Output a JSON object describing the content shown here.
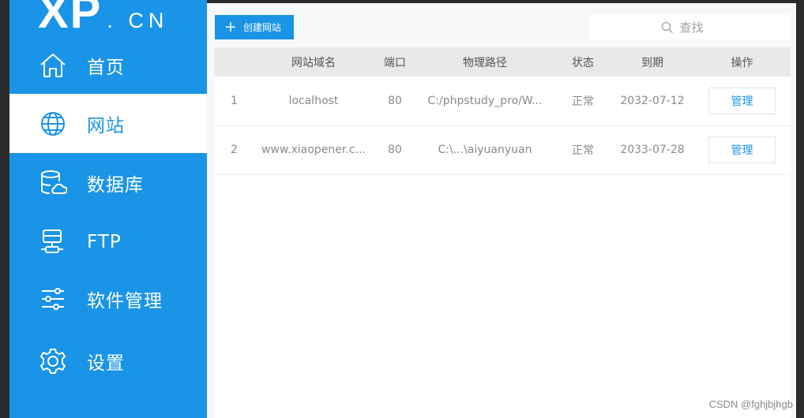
{
  "logo": {
    "main": "XP",
    "suffix": ". CN"
  },
  "sidebar": {
    "items": [
      {
        "label": "首页",
        "icon": "home-icon"
      },
      {
        "label": "网站",
        "icon": "globe-icon",
        "active": true
      },
      {
        "label": "数据库",
        "icon": "database-icon"
      },
      {
        "label": "FTP",
        "icon": "ftp-icon"
      },
      {
        "label": "软件管理",
        "icon": "sliders-icon"
      },
      {
        "label": "设置",
        "icon": "gear-icon"
      }
    ]
  },
  "toolbar": {
    "create_label": "创建网站",
    "search_placeholder": "查找"
  },
  "table": {
    "headers": [
      "",
      "网站域名",
      "端口",
      "物理路径",
      "状态",
      "到期",
      "操作"
    ],
    "rows": [
      {
        "index": "1",
        "domain": "localhost",
        "port": "80",
        "path": "C:/phpstudy_pro/W...",
        "status": "正常",
        "expiry": "2032-07-12",
        "action": "管理"
      },
      {
        "index": "2",
        "domain": "www.xiaopener.c...",
        "port": "80",
        "path": "C:\\...\\aiyuanyuan",
        "status": "正常",
        "expiry": "2033-07-28",
        "action": "管理"
      }
    ]
  },
  "watermark": "CSDN @fghjbjhgb",
  "colors": {
    "accent": "#1a94e6",
    "header_bg": "#e9e9e9"
  }
}
